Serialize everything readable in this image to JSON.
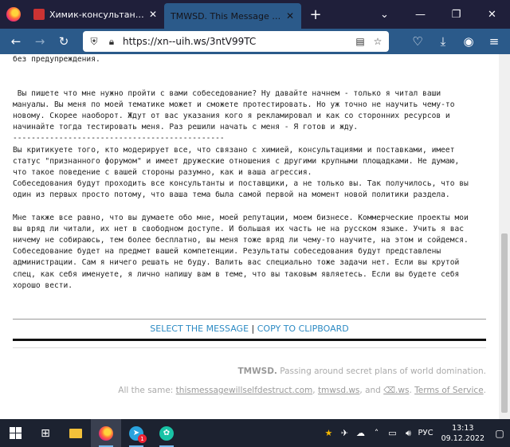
{
  "browser": {
    "tabs": [
      {
        "title": "Химик-консультант | RuTOR – главная",
        "active": false
      },
      {
        "title": "TMWSD. This Message Will Self-Destruct",
        "active": true
      }
    ],
    "url": "https://xn--uih.ws/3ntV99TC"
  },
  "message": {
    "lines": [
      "без предупреждения.",
      "",
      "",
      " Вы пишете что мне нужно пройти с вами собеседование? Ну давайте начнем - только я читал ваши",
      "мануалы. Вы меня по моей тематике может и сможете протестировать. Но уж точно не научить чему-то",
      "новому. Скорее наоборот. Ждут от вас указания кого я рекламировал и как со сторонних ресурсов и",
      "начинайте тогда тестировать меня. Раз решили начать с меня - Я готов и жду.",
      "----------------------------------------------",
      "Вы критикуете того, кто модерирует все, что связано с химией, консультациями и поставками, имеет",
      "статус \"признанного форумом\" и имеет дружеские отношения с другими крупными площадками. Не думаю,",
      "что такое поведение с вашей стороны разумно, как и ваша агрессия.",
      "Собеседования будут проходить все консультанты и поставщики, а не только вы. Так получилось, что вы",
      "один из первых просто потому, что ваша тема была самой первой на момент новой политики раздела.",
      "",
      "Мне также все равно, что вы думаете обо мне, моей репутации, моем бизнесе. Коммерческие проекты мои",
      "вы вряд ли читали, их нет в свободном доступе. И большая их часть не на русском языке. Учить я вас",
      "ничему не собираюсь, тем более бесплатно, вы меня тоже вряд ли чему-то научите, на этом и сойдемся.",
      "Собеседование будет на предмет вашей компетенции. Результаты собеседования будут представлены",
      "администрации. Сам я ничего решать не буду. Валить вас специально тоже задачи нет. Если вы крутой",
      "спец, как себя именуете, я лично напишу вам в теме, что вы таковым являетесь. Если вы будете себя",
      "хорошо вести."
    ]
  },
  "actions": {
    "select": "SELECT THE MESSAGE",
    "separator": "|",
    "copy": "COPY TO CLIPBOARD"
  },
  "footer": {
    "brand": "TMWSD.",
    "tagline": " Passing around secret plans of world domination.",
    "same_prefix": "All the same: ",
    "link1": "thismessagewillselfdestruct.com",
    "comma": ", ",
    "link2": "tmwsd.ws",
    "and": ", and ",
    "link3": "⌫.ws",
    "dot": ". ",
    "link4": "Terms of Service",
    "end": "."
  },
  "taskbar": {
    "lang": "РУС",
    "time": "13:13",
    "date": "09.12.2022",
    "telegram_badge": "1"
  }
}
